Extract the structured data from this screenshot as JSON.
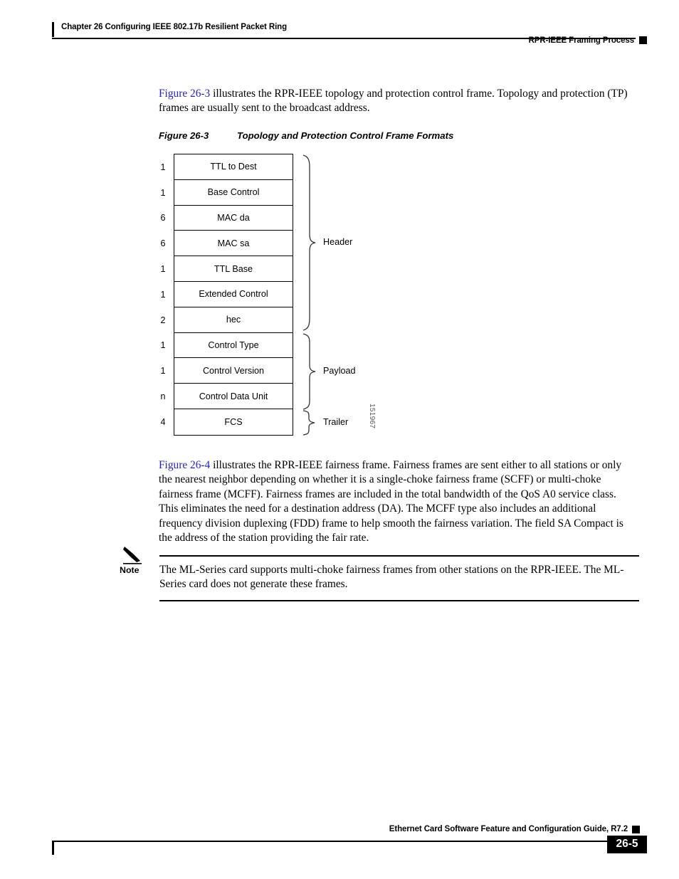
{
  "header": {
    "chapter": "Chapter 26      Configuring IEEE 802.17b Resilient Packet Ring",
    "section": "RPR-IEEE Framing Process"
  },
  "intro_paragraph": {
    "xref": "Figure 26-3",
    "rest": " illustrates the RPR-IEEE topology and protection control frame. Topology and protection (TP) frames are usually sent to the broadcast address."
  },
  "figure": {
    "number": "Figure 26-3",
    "title": "Topology and Protection Control Frame Formats",
    "art_id": "151967",
    "rows": [
      {
        "size": "1",
        "label": "TTL to Dest"
      },
      {
        "size": "1",
        "label": "Base Control"
      },
      {
        "size": "6",
        "label": "MAC da"
      },
      {
        "size": "6",
        "label": "MAC sa"
      },
      {
        "size": "1",
        "label": "TTL Base"
      },
      {
        "size": "1",
        "label": "Extended Control"
      },
      {
        "size": "2",
        "label": "hec"
      },
      {
        "size": "1",
        "label": "Control Type"
      },
      {
        "size": "1",
        "label": "Control Version"
      },
      {
        "size": "n",
        "label": "Control Data Unit"
      },
      {
        "size": "4",
        "label": "FCS"
      }
    ],
    "groups": [
      {
        "label": "Header"
      },
      {
        "label": "Payload"
      },
      {
        "label": "Trailer"
      }
    ]
  },
  "second_paragraph": {
    "xref": "Figure 26-4",
    "rest": " illustrates the RPR-IEEE fairness frame. Fairness frames are sent either to all stations or only the nearest neighbor depending on whether it is a single-choke fairness frame (SCFF) or multi-choke fairness frame (MCFF). Fairness frames are included in the total bandwidth of the QoS A0 service class. This eliminates the need for a destination address (DA). The MCFF type also includes an additional frequency division duplexing (FDD) frame to help smooth the fairness variation. The field SA Compact is the address of the station providing the fair rate."
  },
  "note": {
    "label": "Note",
    "text": "The ML-Series card supports multi-choke fairness frames from other stations on the RPR-IEEE. The ML-Series card does not generate these frames."
  },
  "footer": {
    "title": "Ethernet Card Software Feature and Configuration Guide, R7.2",
    "page": "26-5"
  }
}
